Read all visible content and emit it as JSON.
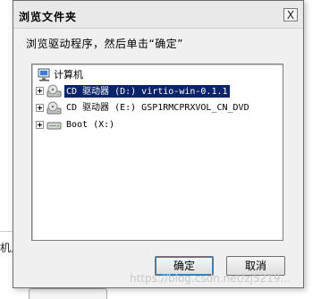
{
  "dialog": {
    "title": "浏览文件夹",
    "close_symbol": "X",
    "instruction": "浏览驱动程序，然后单击“确定”",
    "tree": {
      "root_label": "计算机",
      "items": [
        {
          "label": "CD 驱动器 (D:) virtio-win-0.1.1",
          "selected": true
        },
        {
          "label": "CD 驱动器 (E:) GSP1RMCPRXVOL_CN_DVD",
          "selected": false
        },
        {
          "label": "Boot (X:)",
          "selected": false
        }
      ]
    },
    "buttons": {
      "ok": "确定",
      "cancel": "取消"
    }
  },
  "background": {
    "left_text": "机上",
    "watermark": "https://blog.csdn.net/zj5219..."
  },
  "colors": {
    "selection": "#0a246a",
    "dialog_bg": "#f0f0f0"
  }
}
